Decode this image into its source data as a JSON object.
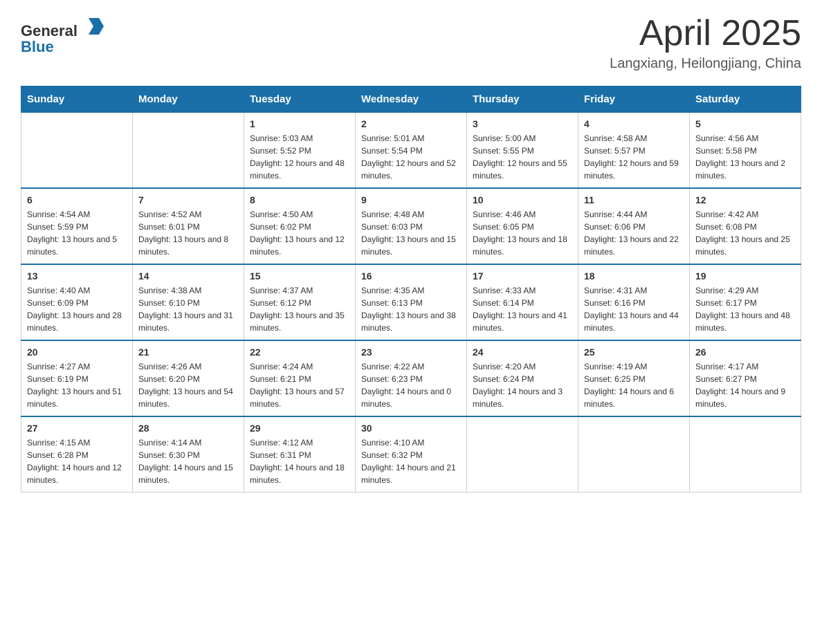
{
  "header": {
    "logo_general": "General",
    "logo_blue": "Blue",
    "title": "April 2025",
    "subtitle": "Langxiang, Heilongjiang, China"
  },
  "weekdays": [
    "Sunday",
    "Monday",
    "Tuesday",
    "Wednesday",
    "Thursday",
    "Friday",
    "Saturday"
  ],
  "weeks": [
    [
      {
        "day": "",
        "sunrise": "",
        "sunset": "",
        "daylight": ""
      },
      {
        "day": "",
        "sunrise": "",
        "sunset": "",
        "daylight": ""
      },
      {
        "day": "1",
        "sunrise": "Sunrise: 5:03 AM",
        "sunset": "Sunset: 5:52 PM",
        "daylight": "Daylight: 12 hours and 48 minutes."
      },
      {
        "day": "2",
        "sunrise": "Sunrise: 5:01 AM",
        "sunset": "Sunset: 5:54 PM",
        "daylight": "Daylight: 12 hours and 52 minutes."
      },
      {
        "day": "3",
        "sunrise": "Sunrise: 5:00 AM",
        "sunset": "Sunset: 5:55 PM",
        "daylight": "Daylight: 12 hours and 55 minutes."
      },
      {
        "day": "4",
        "sunrise": "Sunrise: 4:58 AM",
        "sunset": "Sunset: 5:57 PM",
        "daylight": "Daylight: 12 hours and 59 minutes."
      },
      {
        "day": "5",
        "sunrise": "Sunrise: 4:56 AM",
        "sunset": "Sunset: 5:58 PM",
        "daylight": "Daylight: 13 hours and 2 minutes."
      }
    ],
    [
      {
        "day": "6",
        "sunrise": "Sunrise: 4:54 AM",
        "sunset": "Sunset: 5:59 PM",
        "daylight": "Daylight: 13 hours and 5 minutes."
      },
      {
        "day": "7",
        "sunrise": "Sunrise: 4:52 AM",
        "sunset": "Sunset: 6:01 PM",
        "daylight": "Daylight: 13 hours and 8 minutes."
      },
      {
        "day": "8",
        "sunrise": "Sunrise: 4:50 AM",
        "sunset": "Sunset: 6:02 PM",
        "daylight": "Daylight: 13 hours and 12 minutes."
      },
      {
        "day": "9",
        "sunrise": "Sunrise: 4:48 AM",
        "sunset": "Sunset: 6:03 PM",
        "daylight": "Daylight: 13 hours and 15 minutes."
      },
      {
        "day": "10",
        "sunrise": "Sunrise: 4:46 AM",
        "sunset": "Sunset: 6:05 PM",
        "daylight": "Daylight: 13 hours and 18 minutes."
      },
      {
        "day": "11",
        "sunrise": "Sunrise: 4:44 AM",
        "sunset": "Sunset: 6:06 PM",
        "daylight": "Daylight: 13 hours and 22 minutes."
      },
      {
        "day": "12",
        "sunrise": "Sunrise: 4:42 AM",
        "sunset": "Sunset: 6:08 PM",
        "daylight": "Daylight: 13 hours and 25 minutes."
      }
    ],
    [
      {
        "day": "13",
        "sunrise": "Sunrise: 4:40 AM",
        "sunset": "Sunset: 6:09 PM",
        "daylight": "Daylight: 13 hours and 28 minutes."
      },
      {
        "day": "14",
        "sunrise": "Sunrise: 4:38 AM",
        "sunset": "Sunset: 6:10 PM",
        "daylight": "Daylight: 13 hours and 31 minutes."
      },
      {
        "day": "15",
        "sunrise": "Sunrise: 4:37 AM",
        "sunset": "Sunset: 6:12 PM",
        "daylight": "Daylight: 13 hours and 35 minutes."
      },
      {
        "day": "16",
        "sunrise": "Sunrise: 4:35 AM",
        "sunset": "Sunset: 6:13 PM",
        "daylight": "Daylight: 13 hours and 38 minutes."
      },
      {
        "day": "17",
        "sunrise": "Sunrise: 4:33 AM",
        "sunset": "Sunset: 6:14 PM",
        "daylight": "Daylight: 13 hours and 41 minutes."
      },
      {
        "day": "18",
        "sunrise": "Sunrise: 4:31 AM",
        "sunset": "Sunset: 6:16 PM",
        "daylight": "Daylight: 13 hours and 44 minutes."
      },
      {
        "day": "19",
        "sunrise": "Sunrise: 4:29 AM",
        "sunset": "Sunset: 6:17 PM",
        "daylight": "Daylight: 13 hours and 48 minutes."
      }
    ],
    [
      {
        "day": "20",
        "sunrise": "Sunrise: 4:27 AM",
        "sunset": "Sunset: 6:19 PM",
        "daylight": "Daylight: 13 hours and 51 minutes."
      },
      {
        "day": "21",
        "sunrise": "Sunrise: 4:26 AM",
        "sunset": "Sunset: 6:20 PM",
        "daylight": "Daylight: 13 hours and 54 minutes."
      },
      {
        "day": "22",
        "sunrise": "Sunrise: 4:24 AM",
        "sunset": "Sunset: 6:21 PM",
        "daylight": "Daylight: 13 hours and 57 minutes."
      },
      {
        "day": "23",
        "sunrise": "Sunrise: 4:22 AM",
        "sunset": "Sunset: 6:23 PM",
        "daylight": "Daylight: 14 hours and 0 minutes."
      },
      {
        "day": "24",
        "sunrise": "Sunrise: 4:20 AM",
        "sunset": "Sunset: 6:24 PM",
        "daylight": "Daylight: 14 hours and 3 minutes."
      },
      {
        "day": "25",
        "sunrise": "Sunrise: 4:19 AM",
        "sunset": "Sunset: 6:25 PM",
        "daylight": "Daylight: 14 hours and 6 minutes."
      },
      {
        "day": "26",
        "sunrise": "Sunrise: 4:17 AM",
        "sunset": "Sunset: 6:27 PM",
        "daylight": "Daylight: 14 hours and 9 minutes."
      }
    ],
    [
      {
        "day": "27",
        "sunrise": "Sunrise: 4:15 AM",
        "sunset": "Sunset: 6:28 PM",
        "daylight": "Daylight: 14 hours and 12 minutes."
      },
      {
        "day": "28",
        "sunrise": "Sunrise: 4:14 AM",
        "sunset": "Sunset: 6:30 PM",
        "daylight": "Daylight: 14 hours and 15 minutes."
      },
      {
        "day": "29",
        "sunrise": "Sunrise: 4:12 AM",
        "sunset": "Sunset: 6:31 PM",
        "daylight": "Daylight: 14 hours and 18 minutes."
      },
      {
        "day": "30",
        "sunrise": "Sunrise: 4:10 AM",
        "sunset": "Sunset: 6:32 PM",
        "daylight": "Daylight: 14 hours and 21 minutes."
      },
      {
        "day": "",
        "sunrise": "",
        "sunset": "",
        "daylight": ""
      },
      {
        "day": "",
        "sunrise": "",
        "sunset": "",
        "daylight": ""
      },
      {
        "day": "",
        "sunrise": "",
        "sunset": "",
        "daylight": ""
      }
    ]
  ]
}
